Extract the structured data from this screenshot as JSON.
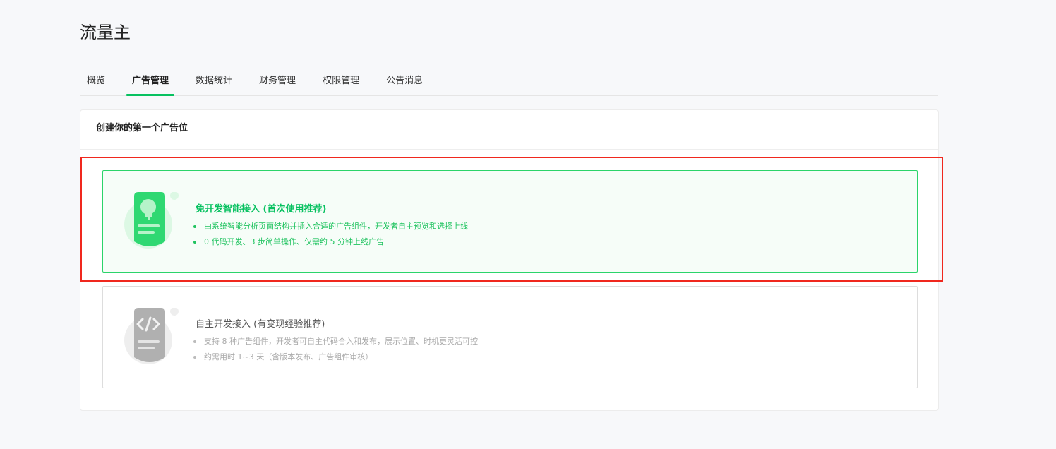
{
  "page": {
    "title": "流量主"
  },
  "tabs": [
    {
      "label": "概览"
    },
    {
      "label": "广告管理",
      "active": true
    },
    {
      "label": "数据统计"
    },
    {
      "label": "财务管理"
    },
    {
      "label": "权限管理"
    },
    {
      "label": "公告消息"
    }
  ],
  "card": {
    "title": "创建你的第一个广告位",
    "options": [
      {
        "icon": "lightbulb-icon",
        "title": "免开发智能接入 (首次使用推荐)",
        "bullets": [
          "由系统智能分析页面结构并插入合适的广告组件，开发者自主预览和选择上线",
          "0 代码开发、3 步简单操作、仅需约 5 分钟上线广告"
        ]
      },
      {
        "icon": "code-icon",
        "title": "自主开发接入 (有变现经验推荐)",
        "bullets": [
          "支持 8 种广告组件，开发者可自主代码合入和发布，展示位置、时机更灵活可控",
          "约需用时 1~3 天（含版本发布、广告组件审核）"
        ]
      }
    ]
  },
  "colors": {
    "accent": "#07c160",
    "highlight": "#f0281e"
  }
}
